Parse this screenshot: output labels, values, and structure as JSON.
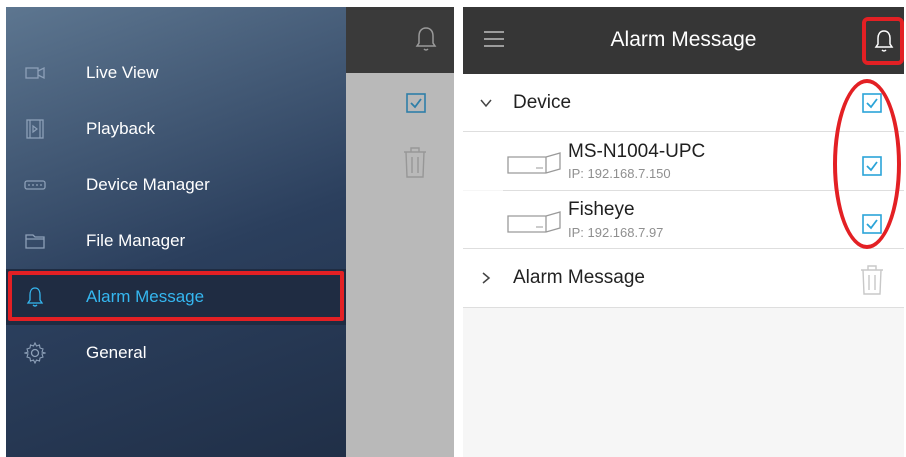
{
  "left": {
    "menu": [
      {
        "label": "Live View",
        "icon": "video-camera-icon"
      },
      {
        "label": "Playback",
        "icon": "film-playback-icon"
      },
      {
        "label": "Device Manager",
        "icon": "nvr-device-icon"
      },
      {
        "label": "File Manager",
        "icon": "folder-icon"
      },
      {
        "label": "Alarm Message",
        "icon": "bell-icon",
        "active": true
      },
      {
        "label": "General",
        "icon": "gear-icon"
      }
    ]
  },
  "right": {
    "title": "Alarm Message",
    "device_section": "Device",
    "devices": [
      {
        "name": "MS-N1004-UPC",
        "ip": "IP: 192.168.7.150",
        "checked": true
      },
      {
        "name": "Fisheye",
        "ip": "IP: 192.168.7.97",
        "checked": true
      }
    ],
    "alarm_section": "Alarm Message"
  },
  "colors": {
    "highlight": "#e32024",
    "accent": "#35b7f0",
    "header": "#363636",
    "checkbox": "#2ba4d8"
  }
}
